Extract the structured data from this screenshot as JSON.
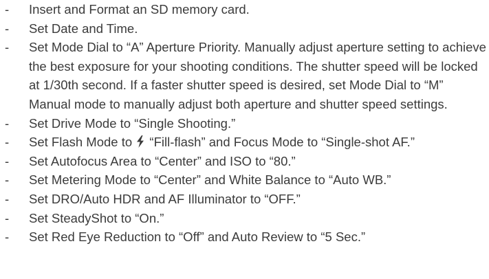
{
  "bullet": "-",
  "items": [
    {
      "text": "Insert and Format an SD memory card."
    },
    {
      "text": "Set Date and Time."
    },
    {
      "text": "Set Mode Dial to “A” Aperture Priority. Manually adjust aperture setting to achieve the best exposure for your shooting conditions. The shutter speed will be locked at 1/30th second. If a faster shutter speed is desired, set Mode Dial to “M” Manual mode to manually adjust both aperture and shutter speed settings."
    },
    {
      "text": "Set Drive Mode to “Single Shooting.”"
    },
    {
      "text_before": "Set Flash Mode to",
      "icon": "flash-icon",
      "text_after": "“Fill-flash” and Focus Mode to “Single-shot AF.”"
    },
    {
      "text": "Set Autofocus Area to “Center” and ISO to “80.”"
    },
    {
      "text": "Set Metering Mode to “Center” and White Balance to “Auto WB.”"
    },
    {
      "text": "Set DRO/Auto HDR and AF Illuminator to “OFF.”"
    },
    {
      "text": "Set SteadyShot to “On.”"
    },
    {
      "text": "Set Red Eye Reduction to “Off” and Auto Review to “5 Sec.”"
    }
  ]
}
